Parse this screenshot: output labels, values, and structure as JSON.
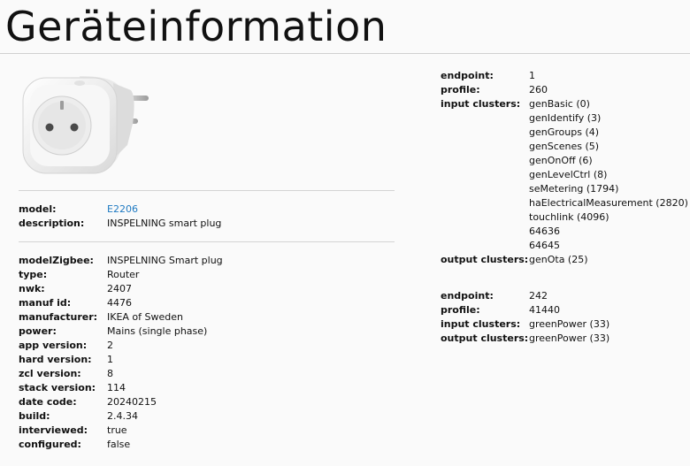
{
  "page": {
    "title": "Geräteinformation"
  },
  "device": {
    "model_label": "model:",
    "model_value": "E2206",
    "description_label": "description:",
    "description_value": "INSPELNING smart plug"
  },
  "details": [
    {
      "label": "modelZigbee:",
      "value": "INSPELNING Smart plug"
    },
    {
      "label": "type:",
      "value": "Router"
    },
    {
      "label": "nwk:",
      "value": "2407"
    },
    {
      "label": "manuf id:",
      "value": "4476"
    },
    {
      "label": "manufacturer:",
      "value": "IKEA of Sweden"
    },
    {
      "label": "power:",
      "value": "Mains (single phase)"
    },
    {
      "label": "app version:",
      "value": "2"
    },
    {
      "label": "hard version:",
      "value": "1"
    },
    {
      "label": "zcl version:",
      "value": "8"
    },
    {
      "label": "stack version:",
      "value": "114"
    },
    {
      "label": "date code:",
      "value": "20240215"
    },
    {
      "label": "build:",
      "value": "2.4.34"
    },
    {
      "label": "interviewed:",
      "value": "true"
    },
    {
      "label": "configured:",
      "value": "false"
    }
  ],
  "endpoints": [
    {
      "endpoint_label": "endpoint:",
      "endpoint_value": "1",
      "profile_label": "profile:",
      "profile_value": "260",
      "input_label": "input clusters:",
      "input_clusters": [
        "genBasic (0)",
        "genIdentify (3)",
        "genGroups (4)",
        "genScenes (5)",
        "genOnOff (6)",
        "genLevelCtrl (8)",
        "seMetering (1794)",
        "haElectricalMeasurement (2820)",
        "touchlink (4096)",
        "64636",
        "64645"
      ],
      "output_label": "output clusters:",
      "output_clusters": [
        "genOta (25)"
      ]
    },
    {
      "endpoint_label": "endpoint:",
      "endpoint_value": "242",
      "profile_label": "profile:",
      "profile_value": "41440",
      "input_label": "input clusters:",
      "input_clusters": [
        "greenPower (33)"
      ],
      "output_label": "output clusters:",
      "output_clusters": [
        "greenPower (33)"
      ]
    }
  ],
  "icons": {
    "device_image": "smart-plug-image"
  }
}
